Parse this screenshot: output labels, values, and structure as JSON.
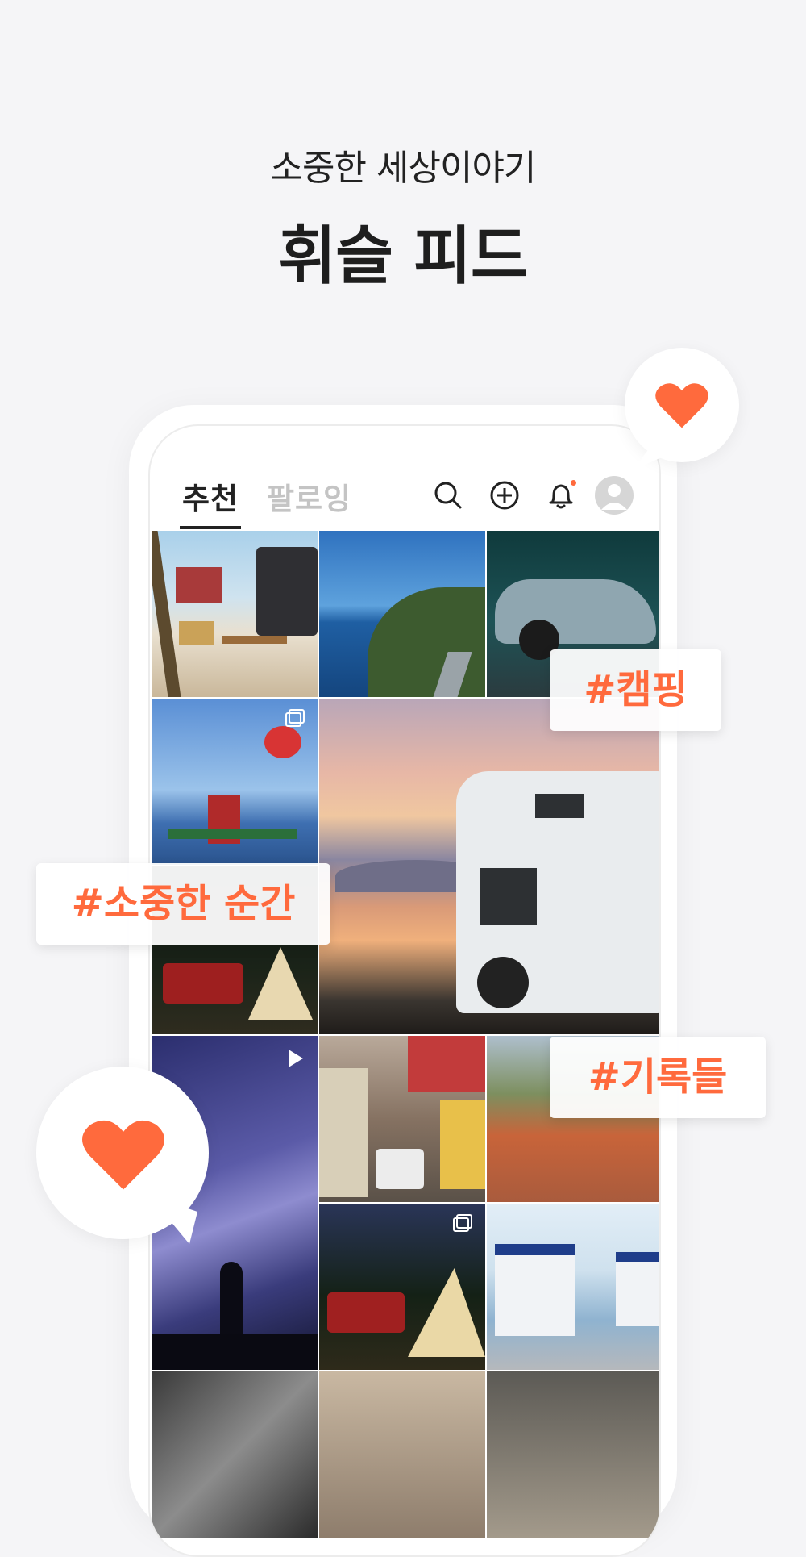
{
  "header": {
    "subtitle": "소중한 세상이야기",
    "title": "휘슬 피드"
  },
  "app": {
    "tabs": [
      {
        "label": "추천",
        "active": true
      },
      {
        "label": "팔로잉",
        "active": false
      }
    ],
    "icons": [
      "search-icon",
      "add-icon",
      "bell-icon",
      "profile-icon"
    ],
    "notification_dot_color": "#ff6a3d"
  },
  "feed": {
    "photos": [
      "camping-beach-photo",
      "coastal-road-photo",
      "sports-car-photo",
      "parasail-boat-photo",
      "campervan-sunset-photo",
      "night-camping-jeep-photo",
      "milky-way-photo",
      "city-tram-street-photo",
      "old-town-rooftops-photo",
      "night-camp-tent-photo",
      "blue-tram-car-photo",
      "architecture-photo",
      "dessert-photo",
      "interior-photo"
    ]
  },
  "tags": {
    "camping": "#캠핑",
    "precious_moment": "#소중한 순간",
    "records": "#기록들"
  },
  "colors": {
    "accent": "#ff6a3d",
    "background": "#f5f5f7",
    "text": "#222222"
  }
}
